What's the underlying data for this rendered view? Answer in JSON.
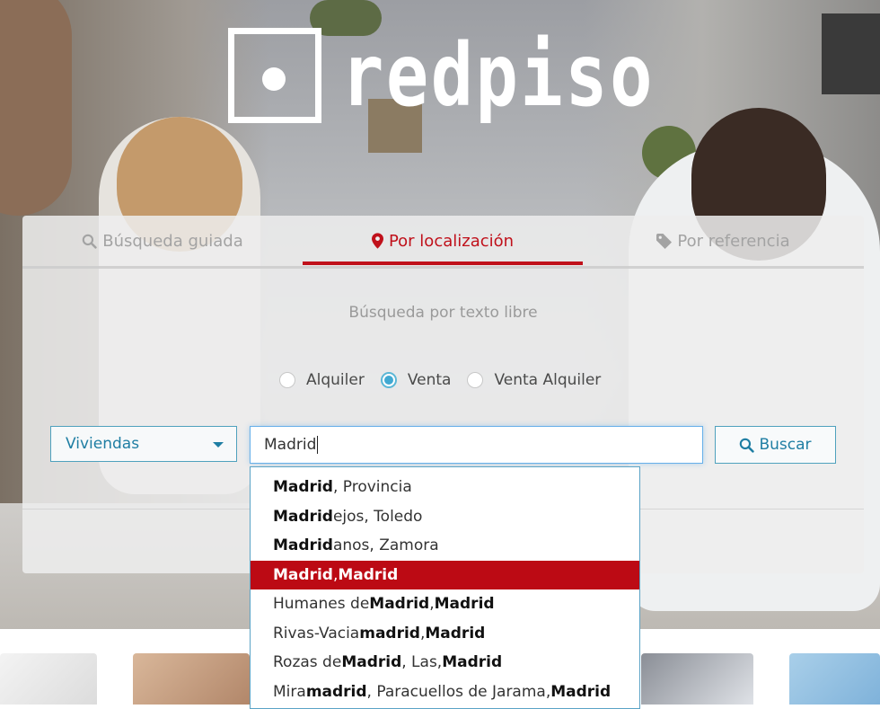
{
  "brand": {
    "name": "redpiso"
  },
  "tabs": [
    {
      "label": "Búsqueda guiada",
      "icon": "search-icon",
      "active": false
    },
    {
      "label": "Por localización",
      "icon": "map-marker-icon",
      "active": true
    },
    {
      "label": "Por referencia",
      "icon": "tag-icon",
      "active": false
    }
  ],
  "colors": {
    "accent": "#c0111b",
    "link": "#1f7ea3",
    "highlight": "#bc0a14"
  },
  "search": {
    "free_text_heading": "Búsqueda por texto libre",
    "operation": {
      "options": [
        "Alquiler",
        "Venta",
        "Venta Alquiler"
      ],
      "selected": "Venta"
    },
    "property_type": "Viviendas",
    "query": "Madrid",
    "button_label": "Buscar",
    "button_icon": "search-icon"
  },
  "suggestions": [
    {
      "parts": [
        {
          "t": "Madrid",
          "b": true
        },
        {
          "t": ", Provincia",
          "b": false
        }
      ],
      "active": false
    },
    {
      "parts": [
        {
          "t": "Madrid",
          "b": true
        },
        {
          "t": "ejos, Toledo",
          "b": false
        }
      ],
      "active": false
    },
    {
      "parts": [
        {
          "t": "Madrid",
          "b": true
        },
        {
          "t": "anos, Zamora",
          "b": false
        }
      ],
      "active": false
    },
    {
      "parts": [
        {
          "t": "Madrid",
          "b": true
        },
        {
          "t": ", ",
          "b": false
        },
        {
          "t": "Madrid",
          "b": true
        }
      ],
      "active": true
    },
    {
      "parts": [
        {
          "t": "Humanes de ",
          "b": false
        },
        {
          "t": "Madrid",
          "b": true
        },
        {
          "t": ", ",
          "b": false
        },
        {
          "t": "Madrid",
          "b": true
        }
      ],
      "active": false
    },
    {
      "parts": [
        {
          "t": "Rivas-Vacia",
          "b": false
        },
        {
          "t": "madrid",
          "b": true
        },
        {
          "t": ", ",
          "b": false
        },
        {
          "t": "Madrid",
          "b": true
        }
      ],
      "active": false
    },
    {
      "parts": [
        {
          "t": "Rozas de ",
          "b": false
        },
        {
          "t": "Madrid",
          "b": true
        },
        {
          "t": ", Las, ",
          "b": false
        },
        {
          "t": "Madrid",
          "b": true
        }
      ],
      "active": false
    },
    {
      "parts": [
        {
          "t": "Mira",
          "b": false
        },
        {
          "t": "madrid",
          "b": true
        },
        {
          "t": ", Paracuellos de Jarama, ",
          "b": false
        },
        {
          "t": "Madrid",
          "b": true
        }
      ],
      "active": false
    }
  ]
}
